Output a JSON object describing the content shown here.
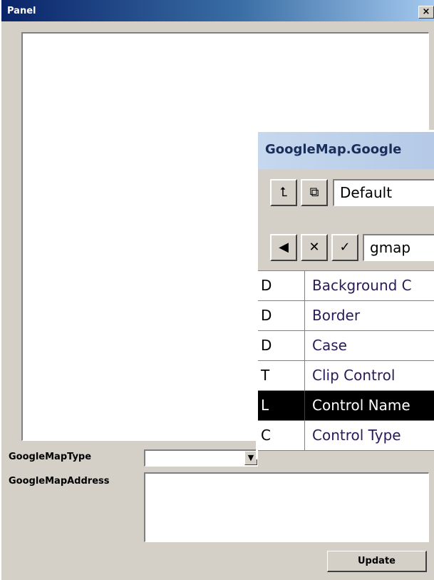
{
  "window": {
    "title": "Panel",
    "close_label": "×"
  },
  "form": {
    "map_type_label": "GoogleMapType",
    "map_type_value": "",
    "combo_arrow": "▼",
    "address_label": "GoogleMapAddress",
    "address_value": "",
    "update_label": "Update"
  },
  "inspector": {
    "title": "GoogleMap.Google",
    "view_select_value": "Default",
    "name_field_value": "gmap",
    "toolbar_icons": [
      "up-level-icon",
      "tree-view-icon",
      "previous-icon",
      "cancel-icon",
      "accept-icon"
    ],
    "toolbar_glyphs": {
      "up": "⮤",
      "tree": "⧉",
      "prev": "◀",
      "cancel": "✕",
      "accept": "✓"
    },
    "properties": [
      {
        "code": "D",
        "name": "Background C"
      },
      {
        "code": "D",
        "name": "Border"
      },
      {
        "code": "D",
        "name": "Case"
      },
      {
        "code": "T",
        "name": "Clip Control"
      },
      {
        "code": "L",
        "name": "Control Name"
      },
      {
        "code": "C",
        "name": "Control Type"
      }
    ],
    "selected_index": 4
  },
  "colors": {
    "face": "#d4d0c8",
    "titlebar_start": "#0a246a",
    "titlebar_end": "#a6caf0",
    "inspector_title_bg": "#c6d8ee",
    "inspector_title_text": "#1a2e5a",
    "selected_row": "#000000"
  }
}
